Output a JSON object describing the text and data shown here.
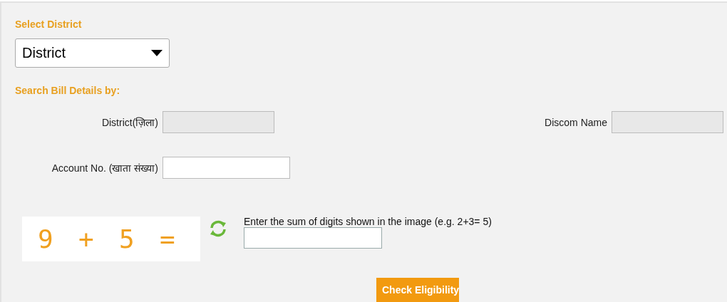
{
  "district_select": {
    "label": "Select District",
    "value": "District"
  },
  "search_section": {
    "heading": "Search Bill Details by:"
  },
  "fields": [
    {
      "label": "District(ज़िला)",
      "disabled": true
    },
    {
      "label": "Discom Name",
      "disabled": true
    },
    {
      "label": "Account No. (खाता संख्या)",
      "disabled": false
    }
  ],
  "captcha": {
    "tokens": [
      "9",
      "+",
      "5",
      "="
    ],
    "instruction": "Enter the sum of digits shown in the image (e.g. 2+3= 5)"
  },
  "submit_button": {
    "label": "Check Eligibility"
  }
}
